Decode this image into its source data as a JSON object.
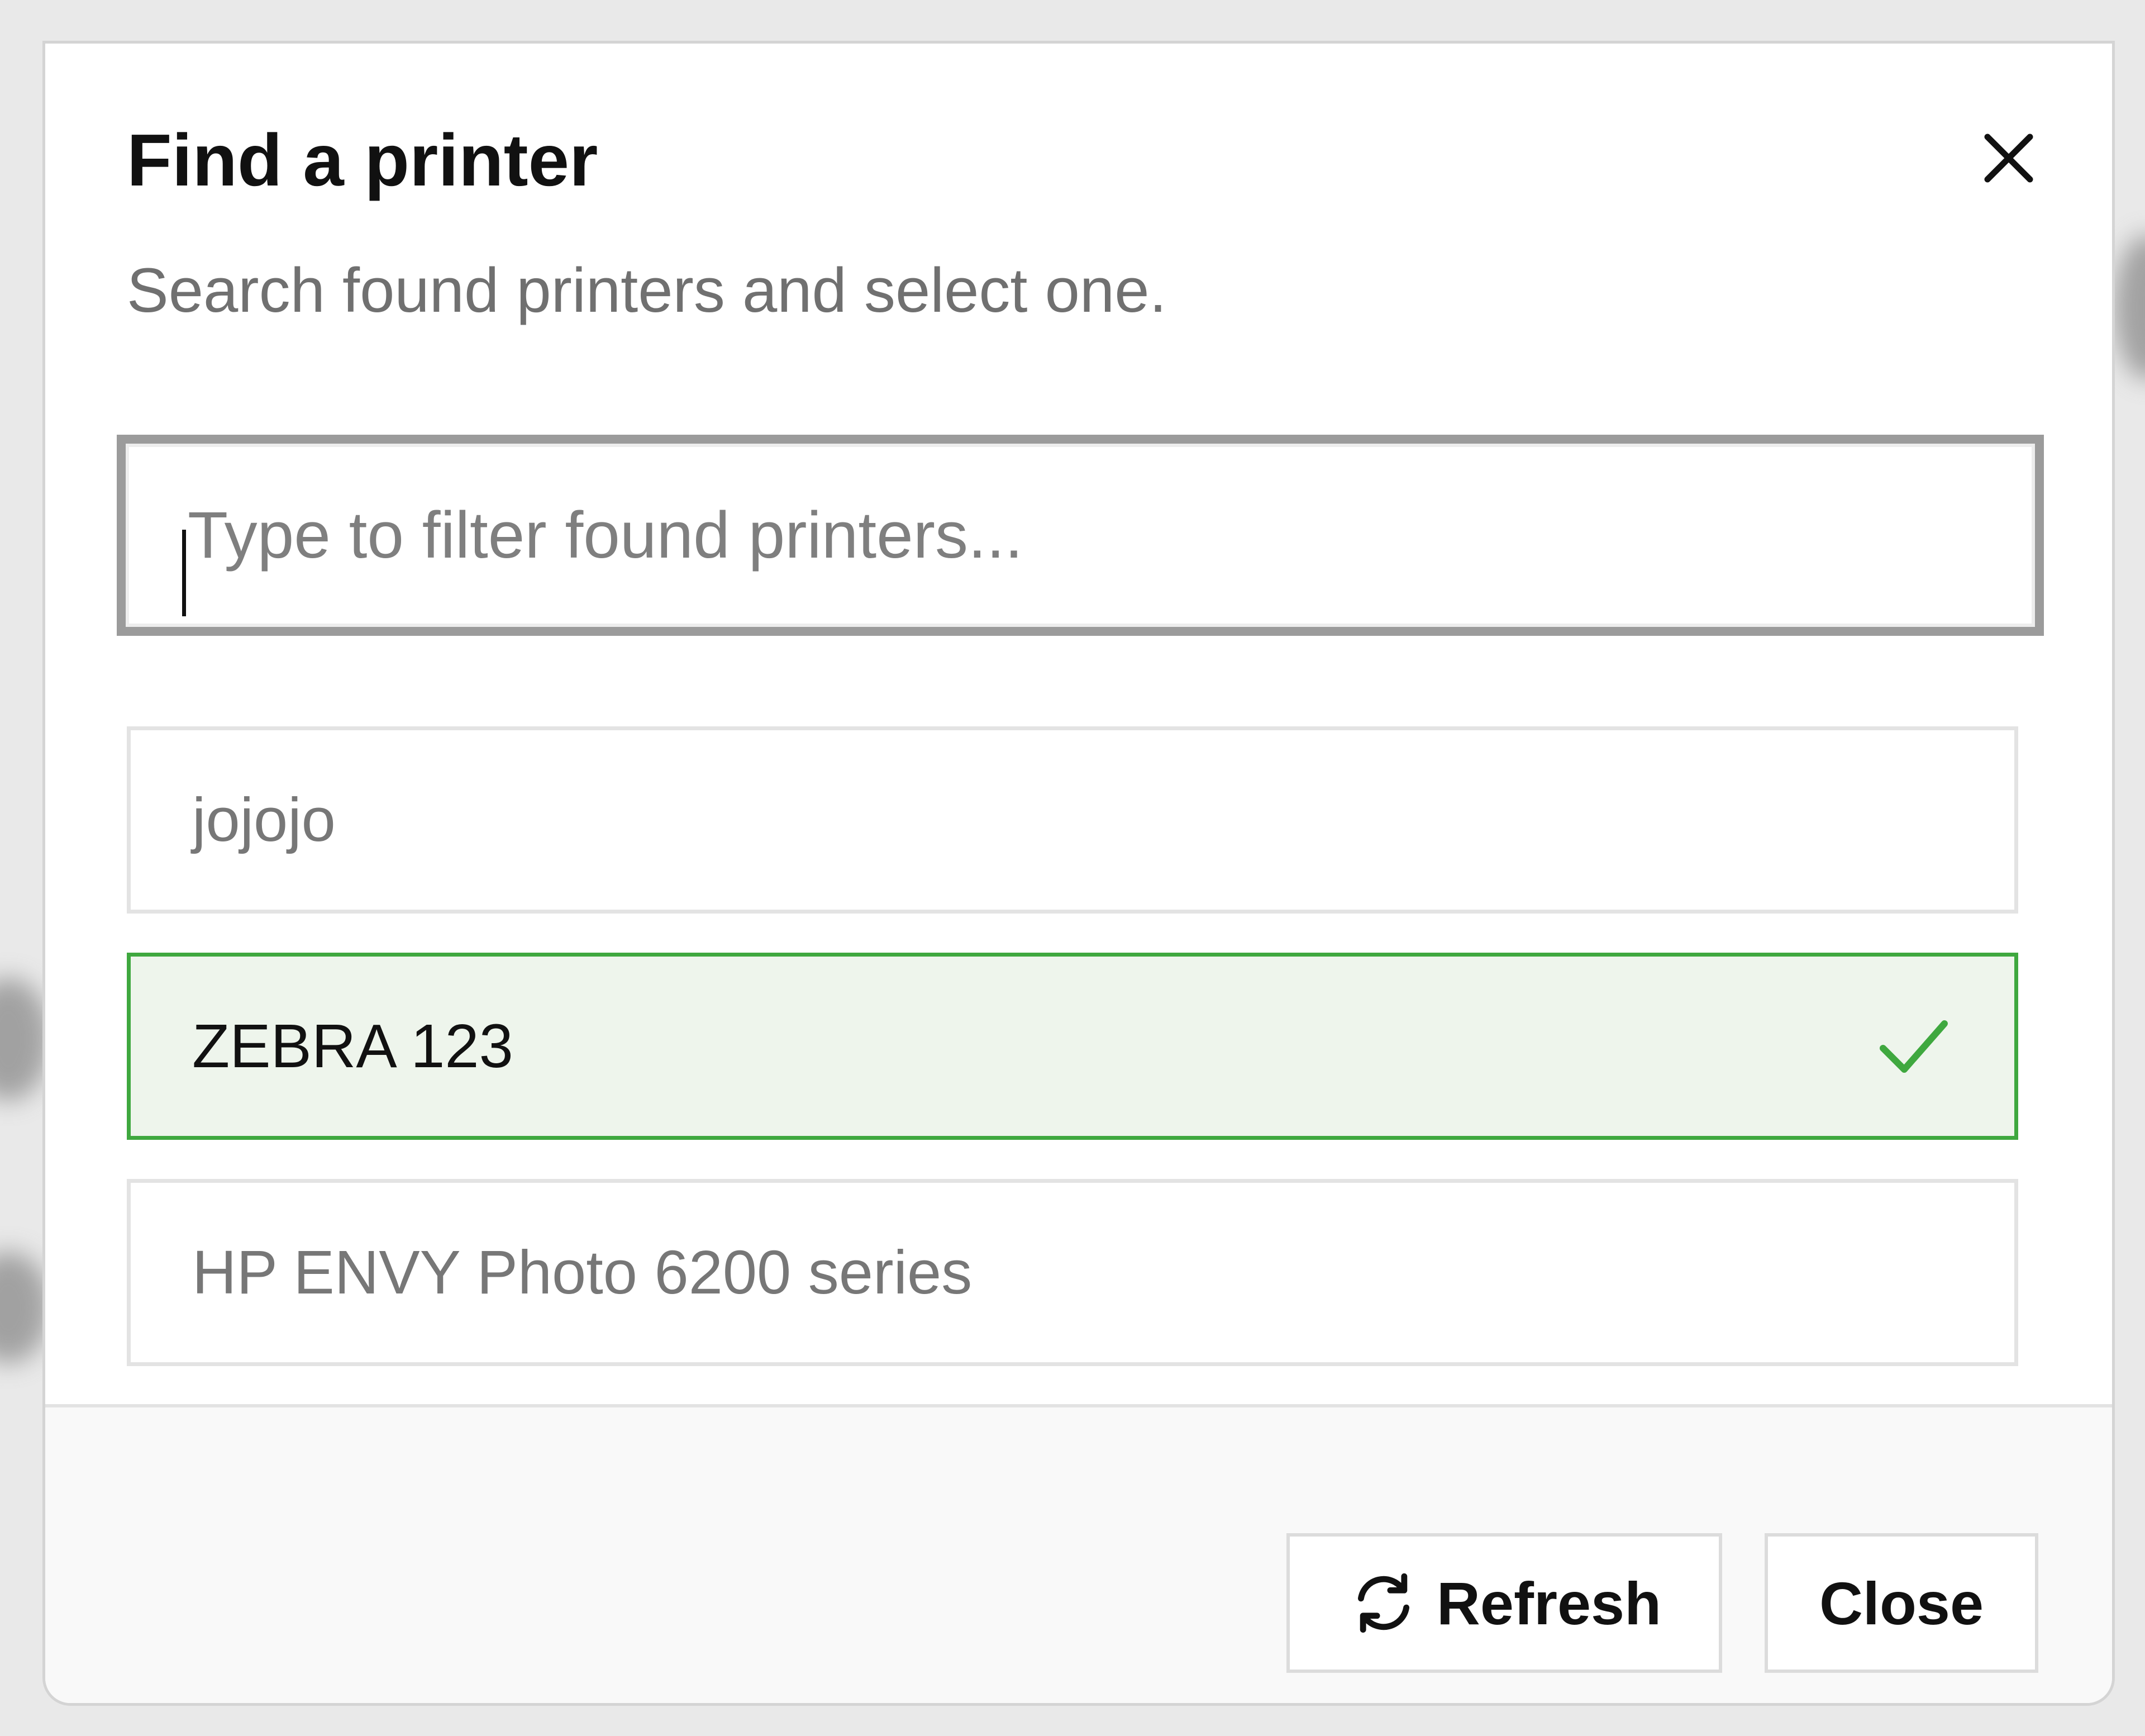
{
  "dialog": {
    "title": "Find a printer",
    "subtitle": "Search found printers and select one."
  },
  "search": {
    "placeholder": "Type to filter found printers...",
    "value": ""
  },
  "printers": [
    {
      "name": "jojojo",
      "selected": false
    },
    {
      "name": "ZEBRA 123",
      "selected": true
    },
    {
      "name": "HP ENVY Photo 6200 series",
      "selected": false
    }
  ],
  "footer": {
    "refresh_label": "Refresh",
    "close_label": "Close"
  },
  "icons": {
    "close": "close-icon",
    "check": "check-icon",
    "refresh": "refresh-icon"
  },
  "colors": {
    "selected_border": "#3fa83f",
    "selected_background": "#eef5ec",
    "check": "#3fa83f"
  }
}
